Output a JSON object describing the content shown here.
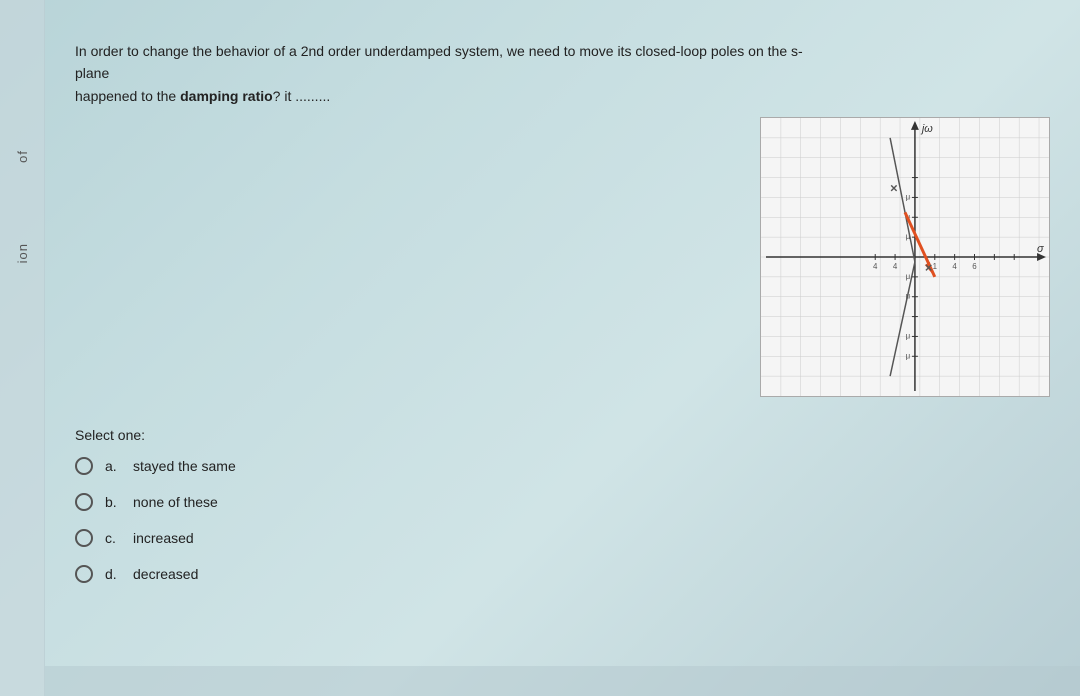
{
  "sidebar": {
    "label1": "of",
    "label2": "ion"
  },
  "question": {
    "text_part1": "In order to change the behavior of a 2nd order underdamped system, we need to move its closed-loop poles on the s-plane",
    "text_part2": "happened to the ",
    "bold_text": "damping ratio",
    "text_part3": "? it .........",
    "select_label": "Select one:"
  },
  "graph": {
    "y_axis_label": "jω",
    "x_axis_label": "σ"
  },
  "options": [
    {
      "letter": "a.",
      "text": "stayed the same"
    },
    {
      "letter": "b.",
      "text": "none of these"
    },
    {
      "letter": "c.",
      "text": "increased"
    },
    {
      "letter": "d.",
      "text": "decreased"
    }
  ],
  "bottom": {
    "text": ""
  }
}
